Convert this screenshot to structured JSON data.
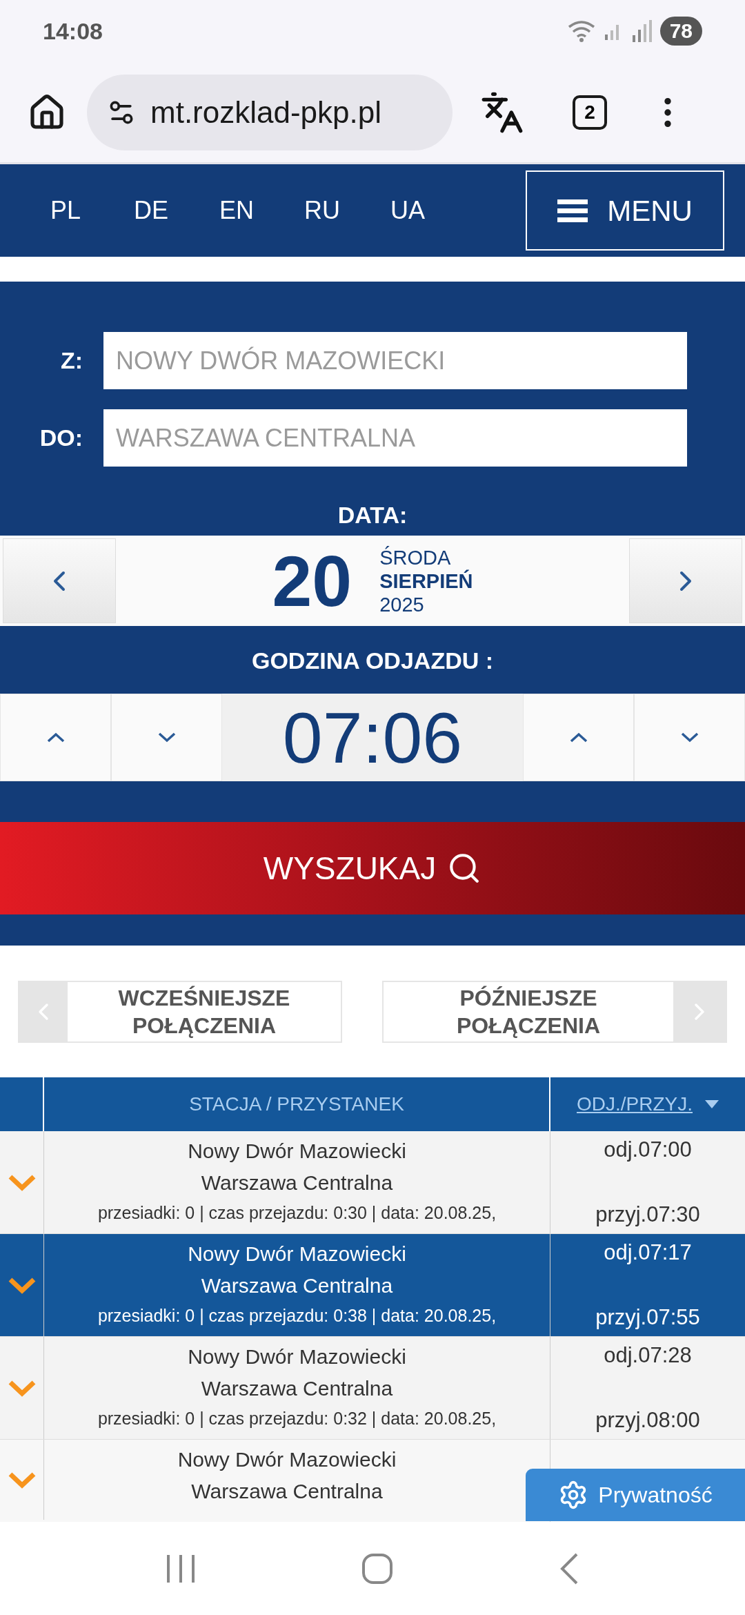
{
  "status_bar": {
    "time": "14:08",
    "battery": "78"
  },
  "browser": {
    "url": "mt.rozklad-pkp.pl",
    "tab_count": "2"
  },
  "nav": {
    "languages": [
      "PL",
      "DE",
      "EN",
      "RU",
      "UA"
    ],
    "menu": "MENU"
  },
  "form": {
    "from_label": "Z:",
    "from_placeholder": "NOWY DWÓR MAZOWIECKI",
    "to_label": "DO:",
    "to_placeholder": "WARSZAWA CENTRALNA",
    "date_label": "DATA:",
    "day": "20",
    "weekday": "ŚRODA",
    "month": "SIERPIEŃ",
    "year": "2025",
    "time_label": "GODZINA ODJAZDU :",
    "time": "07:06",
    "search": "WYSZUKAJ"
  },
  "paging": {
    "earlier": "WCZEŚNIEJSZE POŁĄCZENIA",
    "later": "PÓŹNIEJSZE POŁĄCZENIA"
  },
  "table": {
    "columns": [
      "STACJA / PRZYSTANEK",
      "ODJ./PRZYJ."
    ],
    "rows": [
      {
        "selected": false,
        "from": "Nowy Dwór Mazowiecki",
        "to": "Warszawa Centralna",
        "info": "przesiadki: 0 | czas przejazdu: 0:30 | data: 20.08.25,",
        "departure": "odj.07:00",
        "arrival": "przyj.07:30"
      },
      {
        "selected": true,
        "from": "Nowy Dwór Mazowiecki",
        "to": "Warszawa Centralna",
        "info": "przesiadki: 0 | czas przejazdu: 0:38 | data: 20.08.25,",
        "departure": "odj.07:17",
        "arrival": "przyj.07:55"
      },
      {
        "selected": false,
        "from": "Nowy Dwór Mazowiecki",
        "to": "Warszawa Centralna",
        "info": "przesiadki: 0 | czas przejazdu: 0:32 | data: 20.08.25,",
        "departure": "odj.07:28",
        "arrival": "przyj.08:00"
      },
      {
        "selected": false,
        "from": "Nowy Dwór Mazowiecki",
        "to": "Warszawa Centralna"
      }
    ]
  },
  "privacy_button": "Prywatność"
}
